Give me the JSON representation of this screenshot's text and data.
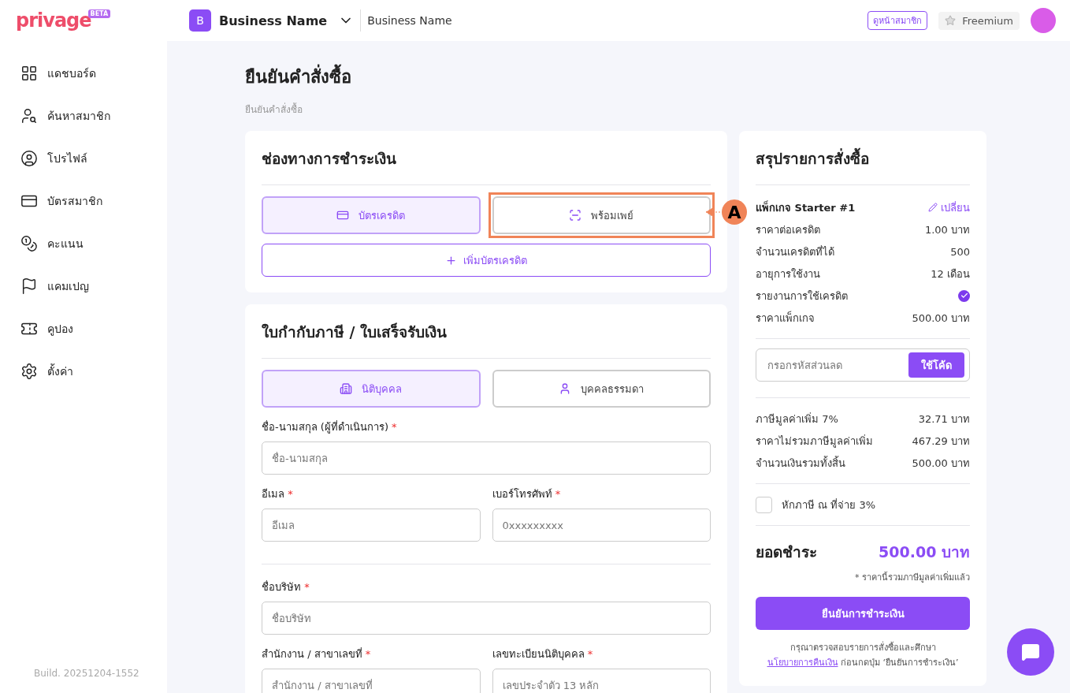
{
  "logo": {
    "text": "privage",
    "badge": "BETA"
  },
  "topbar": {
    "avatar_letter": "B",
    "business": "Business Name",
    "business_sub": "Business Name",
    "member_link": "ดูหน้าสมาชิก",
    "plan": "Freemium"
  },
  "sidebar": {
    "items": [
      {
        "label": "แดชบอร์ด",
        "selected": false
      },
      {
        "label": "ค้นหาสมาชิก",
        "selected": false
      },
      {
        "label": "โปรไฟล์",
        "selected": false
      },
      {
        "label": "บัตรสมาชิก",
        "selected": false
      },
      {
        "label": "คะแนน",
        "selected": false
      },
      {
        "label": "แคมเปญ",
        "selected": false
      },
      {
        "label": "คูปอง",
        "selected": false
      },
      {
        "label": "ตั้งค่า",
        "selected": false
      }
    ],
    "build": "Build. 20251204-1552"
  },
  "page": {
    "title": "ยืนยันคำสั่งซื้อ",
    "breadcrumb": "ยืนยันคำสั่งซื้อ"
  },
  "payment": {
    "title": "ช่องทางการชำระเงิน",
    "methods": [
      {
        "label": "บัตรเครดิต",
        "selected": true,
        "highlighted": false
      },
      {
        "label": "พร้อมเพย์",
        "selected": false,
        "highlighted": true
      }
    ],
    "add_card": "เพิ่มบัตรเครดิต"
  },
  "annotation": {
    "label": "A"
  },
  "invoice": {
    "title": "ใบกำกับภาษี / ใบเสร็จรับเงิน",
    "types": [
      {
        "label": "นิติบุคคล",
        "selected": true
      },
      {
        "label": "บุคคลธรรมดา",
        "selected": false
      }
    ],
    "required_mark": "*",
    "rows": [
      [
        {
          "label": "ชื่อ-นามสกุล (ผู้ที่ดำเนินการ)",
          "required": true,
          "placeholder": "ชื่อ-นามสกุล"
        }
      ],
      [
        {
          "label": "อีเมล",
          "required": true,
          "placeholder": "อีเมล"
        },
        {
          "label": "เบอร์โทรศัพท์",
          "required": true,
          "placeholder": "0xxxxxxxxx"
        }
      ],
      [
        {
          "label": "ชื่อบริษัท",
          "required": true,
          "placeholder": "ชื่อบริษัท"
        }
      ],
      [
        {
          "label": "สำนักงาน / สาขาเลขที่",
          "required": true,
          "placeholder": "สำนักงาน / สาขาเลขที่"
        },
        {
          "label": "เลขทะเบียนนิติบุคคล",
          "required": true,
          "placeholder": "เลขประจำตัว 13 หลัก"
        }
      ]
    ]
  },
  "summary": {
    "title": "สรุปรายการสั่งซื้อ",
    "package": "แพ็กเกจ Starter #1",
    "change": "เปลี่ยน",
    "items": [
      {
        "label": "ราคาต่อเครดิต",
        "kind": "text",
        "value": "1.00 บาท"
      },
      {
        "label": "จำนวนเครดิตที่ได้",
        "kind": "text",
        "value": "500"
      },
      {
        "label": "อายุการใช้งาน",
        "kind": "text",
        "value": "12 เดือน"
      },
      {
        "label": "รายงานการใช้เครดิต",
        "kind": "check",
        "checked": true
      },
      {
        "label": "ราคาแพ็กเกจ",
        "kind": "text",
        "value": "500.00 บาท"
      }
    ],
    "coupon_placeholder": "กรอกรหัสส่วนลด",
    "coupon_button": "ใช้โค้ด",
    "totals": [
      {
        "label": "ภาษีมูลค่าเพิ่ม 7%",
        "value": "32.71 บาท"
      },
      {
        "label": "ราคาไม่รวมภาษีมูลค่าเพิ่ม",
        "value": "467.29 บาท"
      },
      {
        "label": "จำนวนเงินรวมทั้งสิ้น",
        "value": "500.00 บาท"
      }
    ],
    "withholding": {
      "label": "หักภาษี ณ ที่จ่าย 3%",
      "checked": false
    },
    "due_label": "ยอดชำระ",
    "due_value": "500.00 บาท",
    "due_note": "* ราคานี้รวมภาษีมูลค่าเพิ่มแล้ว",
    "confirm": "ยืนยันการชำระเงิน",
    "note_before": "กรุณาตรวจสอบรายการสั่งซื้อและศึกษา",
    "note_link": "นโยบายการคืนเงิน",
    "note_after": "ก่อนกดปุ่ม ‘ยืนยันการชำระเงิน’"
  }
}
